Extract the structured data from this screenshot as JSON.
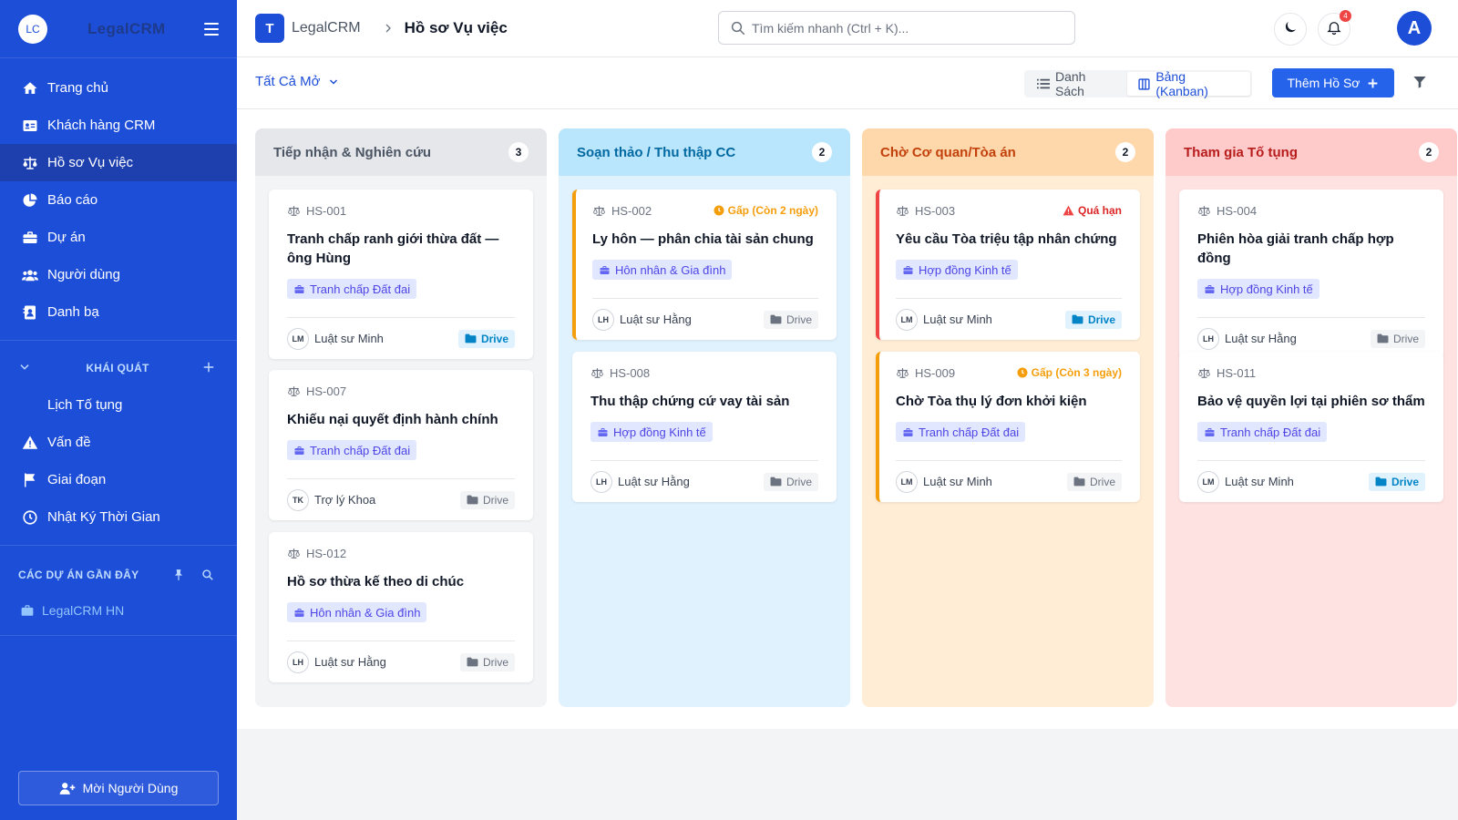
{
  "colors": {
    "primary": "#1d4ed8",
    "accent_orange": "#f59e0b",
    "accent_red": "#ef4444",
    "link": "#2563eb"
  },
  "sidebar": {
    "logo": "LC",
    "brand": "LegalCRM",
    "nav": [
      {
        "label": "Trang chủ",
        "icon": "home-icon"
      },
      {
        "label": "Khách hàng CRM",
        "icon": "contact-card-icon"
      },
      {
        "label": "Hồ sơ Vụ việc",
        "icon": "scale-icon",
        "active": true
      },
      {
        "label": "Báo cáo",
        "icon": "pie-chart-icon"
      },
      {
        "label": "Dự án",
        "icon": "briefcase-icon"
      },
      {
        "label": "Người dùng",
        "icon": "users-icon"
      },
      {
        "label": "Danh bạ",
        "icon": "address-book-icon"
      }
    ],
    "section_overview": "KHÁI QUÁT",
    "overview_items": [
      {
        "label": "Lịch Tố tụng"
      },
      {
        "label": "Vấn đề",
        "icon": "warning-icon"
      },
      {
        "label": "Giai đoạn",
        "icon": "flag-icon"
      },
      {
        "label": "Nhật Ký Thời Gian",
        "icon": "clock-icon"
      }
    ],
    "section_recent": "CÁC DỰ ÁN GẦN ĐÂY",
    "recent_projects": [
      {
        "label": "LegalCRM HN"
      }
    ],
    "invite_label": "Mời Người Dùng"
  },
  "topbar": {
    "logo": "T",
    "brand": "LegalCRM",
    "page_title": "Hồ sơ Vụ việc",
    "search_placeholder": "Tìm kiếm nhanh (Ctrl + K)...",
    "notification_count": "4",
    "avatar": "A"
  },
  "toolbar": {
    "filter_label": "Tất Cả Mở",
    "view_list": "Danh Sách",
    "view_kanban": "Bảng (Kanban)",
    "add_label": "Thêm Hồ Sơ"
  },
  "columns": [
    {
      "title": "Tiếp nhận & Nghiên cứu",
      "count": "3",
      "bg": "#f3f4f6",
      "head_bg": "#e5e7eb",
      "title_color": "#4b5563",
      "cards": [
        {
          "id": "HS-001",
          "title": "Tranh chấp ranh giới thừa đất — ông Hùng",
          "tag": "Tranh chấp Đất đai",
          "initials": "LM",
          "assignee": "Luật sư Minh",
          "drive": "Drive",
          "drive_active": true
        },
        {
          "id": "HS-007",
          "title": "Khiếu nại quyết định hành chính",
          "tag": "Tranh chấp Đất đai",
          "initials": "TK",
          "assignee": "Trợ lý Khoa",
          "drive": "Drive",
          "drive_active": false
        },
        {
          "id": "HS-012",
          "title": "Hồ sơ thừa kế theo di chúc",
          "tag": "Hôn nhân & Gia đình",
          "initials": "LH",
          "assignee": "Luật sư Hằng",
          "drive": "Drive",
          "drive_active": false
        }
      ]
    },
    {
      "title": "Soạn thảo / Thu thập CC",
      "count": "2",
      "bg": "#e0f2fe",
      "head_bg": "#bae6fd",
      "title_color": "#0369a1",
      "cards": [
        {
          "id": "HS-002",
          "title": "Ly hôn — phân chia tài sản chung",
          "tag": "Hôn nhân & Gia đình",
          "initials": "LH",
          "assignee": "Luật sư Hằng",
          "drive": "Drive",
          "drive_active": false,
          "status": "Gấp (Còn 2 ngày)",
          "status_type": "urgent"
        },
        {
          "id": "HS-008",
          "title": "Thu thập chứng cứ vay tài sản",
          "tag": "Hợp đồng Kinh tế",
          "initials": "LH",
          "assignee": "Luật sư Hằng",
          "drive": "Drive",
          "drive_active": false
        }
      ]
    },
    {
      "title": "Chờ Cơ quan/Tòa án",
      "count": "2",
      "bg": "#ffedd5",
      "head_bg": "#fed7aa",
      "title_color": "#c2410c",
      "cards": [
        {
          "id": "HS-003",
          "title": "Yêu cầu Tòa triệu tập nhân chứng",
          "tag": "Hợp đồng Kinh tế",
          "initials": "LM",
          "assignee": "Luật sư Minh",
          "drive": "Drive",
          "drive_active": true,
          "status": "Quá hạn",
          "status_type": "overdue"
        },
        {
          "id": "HS-009",
          "title": "Chờ Tòa thụ lý đơn khởi kiện",
          "tag": "Tranh chấp Đất đai",
          "initials": "LM",
          "assignee": "Luật sư Minh",
          "drive": "Drive",
          "drive_active": false,
          "status": "Gấp (Còn 3 ngày)",
          "status_type": "urgent"
        }
      ]
    },
    {
      "title": "Tham gia Tố tụng",
      "count": "2",
      "bg": "#fee2e2",
      "head_bg": "#fecaca",
      "title_color": "#b91c1c",
      "cards": [
        {
          "id": "HS-004",
          "title": "Phiên hòa giải tranh chấp hợp đồng",
          "tag": "Hợp đồng Kinh tế",
          "initials": "LH",
          "assignee": "Luật sư Hằng",
          "drive": "Drive",
          "drive_active": false
        },
        {
          "id": "HS-011",
          "title": "Bảo vệ quyền lợi tại phiên sơ thẩm",
          "tag": "Tranh chấp Đất đai",
          "initials": "LM",
          "assignee": "Luật sư Minh",
          "drive": "Drive",
          "drive_active": true
        }
      ]
    }
  ]
}
